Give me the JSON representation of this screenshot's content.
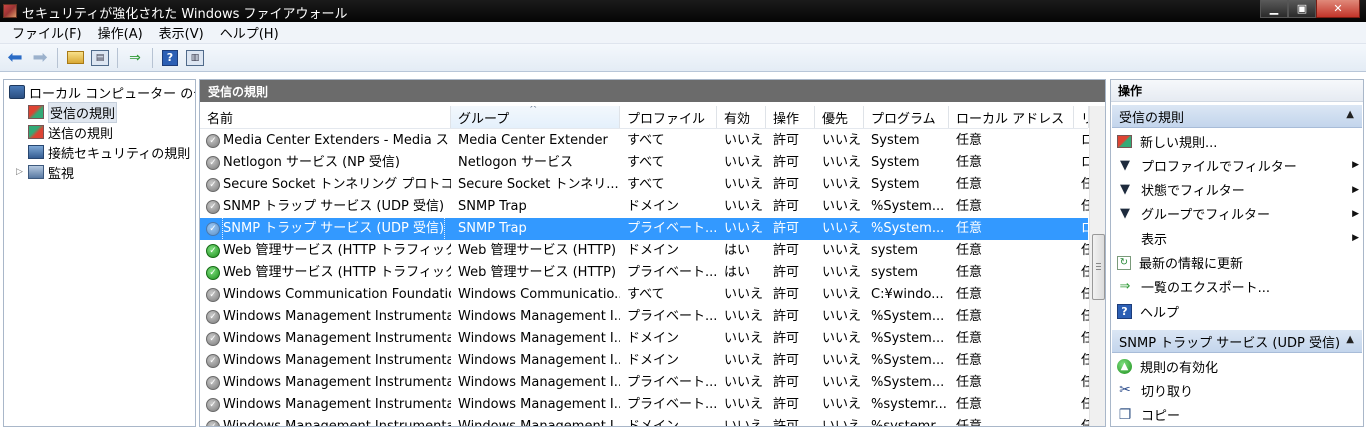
{
  "window": {
    "title": "セキュリティが強化された Windows ファイアウォール",
    "minimize": "▁",
    "maximize": "▣",
    "close": "✕"
  },
  "menu": [
    "ファイル(F)",
    "操作(A)",
    "表示(V)",
    "ヘルプ(H)"
  ],
  "tree": {
    "root": "ローカル コンピューター のセ",
    "items": [
      {
        "label": "受信の規則",
        "icon": "inbound-rules-icon",
        "selected": true
      },
      {
        "label": "送信の規則",
        "icon": "outbound-rules-icon",
        "selected": false
      },
      {
        "label": "接続セキュリティの規則",
        "icon": "connection-security-icon",
        "selected": false
      },
      {
        "label": "監視",
        "icon": "monitor-icon",
        "selected": false,
        "expandable": true
      }
    ]
  },
  "center": {
    "header": "受信の規則",
    "columns": [
      "名前",
      "グループ",
      "プロファイル",
      "有効",
      "操作",
      "優先",
      "プログラム",
      "ローカル アドレス",
      "リ"
    ],
    "rows": [
      {
        "name": "Media Center Extenders - Media スト...",
        "group": "Media Center Extender",
        "profile": "すべて",
        "enabled": "いいえ",
        "action": "許可",
        "override": "いいえ",
        "program": "System",
        "local": "任意",
        "remote": "ロ",
        "on": false,
        "selected": false
      },
      {
        "name": "Netlogon サービス (NP 受信)",
        "group": "Netlogon サービス",
        "profile": "すべて",
        "enabled": "いいえ",
        "action": "許可",
        "override": "いいえ",
        "program": "System",
        "local": "任意",
        "remote": "ロ",
        "on": false,
        "selected": false
      },
      {
        "name": "Secure Socket トンネリング プロトコ...",
        "group": "Secure Socket トンネリ...",
        "profile": "すべて",
        "enabled": "いいえ",
        "action": "許可",
        "override": "いいえ",
        "program": "System",
        "local": "任意",
        "remote": "任",
        "on": false,
        "selected": false
      },
      {
        "name": "SNMP トラップ サービス (UDP 受信)",
        "group": "SNMP Trap",
        "profile": "ドメイン",
        "enabled": "いいえ",
        "action": "許可",
        "override": "いいえ",
        "program": "%System...",
        "local": "任意",
        "remote": "任",
        "on": false,
        "selected": false
      },
      {
        "name": "SNMP トラップ サービス (UDP 受信)",
        "group": "SNMP Trap",
        "profile": "プライベート...",
        "enabled": "いいえ",
        "action": "許可",
        "override": "いいえ",
        "program": "%System...",
        "local": "任意",
        "remote": "ロ",
        "on": false,
        "selected": true
      },
      {
        "name": "Web 管理サービス (HTTP トラフィック)",
        "group": "Web 管理サービス (HTTP)",
        "profile": "ドメイン",
        "enabled": "はい",
        "action": "許可",
        "override": "いいえ",
        "program": "system",
        "local": "任意",
        "remote": "任",
        "on": true,
        "selected": false
      },
      {
        "name": "Web 管理サービス (HTTP トラフィック)",
        "group": "Web 管理サービス (HTTP)",
        "profile": "プライベート...",
        "enabled": "はい",
        "action": "許可",
        "override": "いいえ",
        "program": "system",
        "local": "任意",
        "remote": "任",
        "on": true,
        "selected": false
      },
      {
        "name": "Windows Communication Foundatio...",
        "group": "Windows Communicatio...",
        "profile": "すべて",
        "enabled": "いいえ",
        "action": "許可",
        "override": "いいえ",
        "program": "C:¥windo...",
        "local": "任意",
        "remote": "任",
        "on": false,
        "selected": false
      },
      {
        "name": "Windows Management Instrumentat...",
        "group": "Windows Management I...",
        "profile": "プライベート...",
        "enabled": "いいえ",
        "action": "許可",
        "override": "いいえ",
        "program": "%System...",
        "local": "任意",
        "remote": "任",
        "on": false,
        "selected": false
      },
      {
        "name": "Windows Management Instrumentat...",
        "group": "Windows Management I...",
        "profile": "ドメイン",
        "enabled": "いいえ",
        "action": "許可",
        "override": "いいえ",
        "program": "%System...",
        "local": "任意",
        "remote": "任",
        "on": false,
        "selected": false
      },
      {
        "name": "Windows Management Instrumentat...",
        "group": "Windows Management I...",
        "profile": "ドメイン",
        "enabled": "いいえ",
        "action": "許可",
        "override": "いいえ",
        "program": "%System...",
        "local": "任意",
        "remote": "任",
        "on": false,
        "selected": false
      },
      {
        "name": "Windows Management Instrumentat...",
        "group": "Windows Management I...",
        "profile": "プライベート...",
        "enabled": "いいえ",
        "action": "許可",
        "override": "いいえ",
        "program": "%System...",
        "local": "任意",
        "remote": "任",
        "on": false,
        "selected": false
      },
      {
        "name": "Windows Management Instrumentat...",
        "group": "Windows Management I...",
        "profile": "プライベート...",
        "enabled": "いいえ",
        "action": "許可",
        "override": "いいえ",
        "program": "%systemr...",
        "local": "任意",
        "remote": "任",
        "on": false,
        "selected": false
      },
      {
        "name": "Windows Management Instrumentat...",
        "group": "Windows Management I...",
        "profile": "ドメイン",
        "enabled": "いいえ",
        "action": "許可",
        "override": "いいえ",
        "program": "%systemr...",
        "local": "任意",
        "remote": "任",
        "on": false,
        "selected": false
      }
    ]
  },
  "actions": {
    "title": "操作",
    "section1": {
      "title": "受信の規則",
      "items": [
        {
          "label": "新しい規則...",
          "icon": "new-rule-icon",
          "submenu": false
        },
        {
          "label": "プロファイルでフィルター",
          "icon": "filter-icon",
          "submenu": true
        },
        {
          "label": "状態でフィルター",
          "icon": "filter-icon",
          "submenu": true
        },
        {
          "label": "グループでフィルター",
          "icon": "filter-icon",
          "submenu": true
        },
        {
          "label": "表示",
          "icon": "",
          "submenu": true
        },
        {
          "label": "最新の情報に更新",
          "icon": "refresh-icon",
          "submenu": false
        },
        {
          "label": "一覧のエクスポート...",
          "icon": "export-icon",
          "submenu": false
        },
        {
          "label": "ヘルプ",
          "icon": "help-icon",
          "submenu": false
        }
      ]
    },
    "section2": {
      "title": "SNMP トラップ サービス (UDP 受信)",
      "items": [
        {
          "label": "規則の有効化",
          "icon": "enable-rule-icon"
        },
        {
          "label": "切り取り",
          "icon": "cut-icon"
        },
        {
          "label": "コピー",
          "icon": "copy-icon"
        }
      ]
    }
  }
}
